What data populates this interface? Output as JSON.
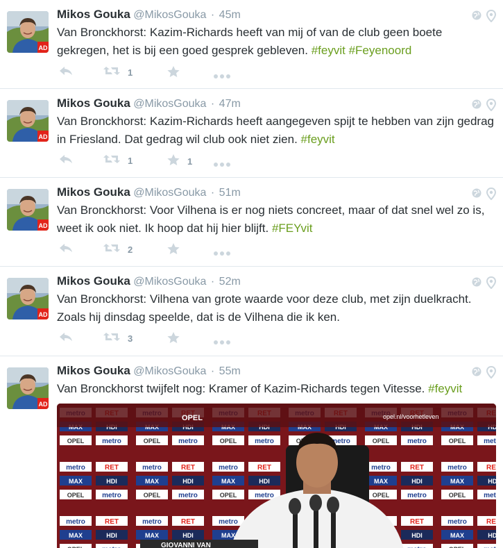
{
  "tweets": [
    {
      "name": "Mikos Gouka",
      "handle": "@MikosGouka",
      "time": "45m",
      "text_parts": [
        {
          "t": "Van Bronckhorst: Kazim-Richards heeft van mij of van de club geen boete gekregen, het is bij een goed gesprek gebleven. ",
          "h": false
        },
        {
          "t": "#feyvit",
          "h": true
        },
        {
          "t": " ",
          "h": false
        },
        {
          "t": "#Feyenoord",
          "h": true
        }
      ],
      "retweets": "1",
      "favorites": ""
    },
    {
      "name": "Mikos Gouka",
      "handle": "@MikosGouka",
      "time": "47m",
      "text_parts": [
        {
          "t": "Van Bronckhorst: Kazim-Richards heeft aangegeven spijt te hebben van zijn gedrag in Friesland. Dat gedrag wil club ook niet zien. ",
          "h": false
        },
        {
          "t": "#feyvit",
          "h": true
        }
      ],
      "retweets": "1",
      "favorites": "1"
    },
    {
      "name": "Mikos Gouka",
      "handle": "@MikosGouka",
      "time": "51m",
      "text_parts": [
        {
          "t": "Van Bronckhorst: Voor Vilhena is er nog niets concreet, maar of dat snel wel zo is, weet ik ook niet. Ik hoop dat hij hier blijft. ",
          "h": false
        },
        {
          "t": "#FEYvit",
          "h": true
        }
      ],
      "retweets": "2",
      "favorites": ""
    },
    {
      "name": "Mikos Gouka",
      "handle": "@MikosGouka",
      "time": "52m",
      "text_parts": [
        {
          "t": "Van Bronckhorst: Vilhena van grote waarde voor deze club, met zijn duelkracht. Zoals hij dinsdag speelde, dat is de Vilhena die ik ken.",
          "h": false
        }
      ],
      "retweets": "3",
      "favorites": ""
    },
    {
      "name": "Mikos Gouka",
      "handle": "@MikosGouka",
      "time": "55m",
      "text_parts": [
        {
          "t": "Van Bronckhorst twijfelt nog: Kramer of Kazim-Richards tegen Vitesse. ",
          "h": false
        },
        {
          "t": "#feyvit",
          "h": true
        }
      ],
      "retweets": "",
      "favorites": ""
    }
  ],
  "media": {
    "sponsor_opel": "OPEL",
    "sponsor_metro": "metro",
    "sponsor_ret": "RET",
    "sponsor_max": "MAX",
    "sponsor_hdi": "HDI",
    "backdrop_url": "opel.nl/voorhetleven",
    "nameplate": "GIOVANNI VAN"
  },
  "colors": {
    "hashtag": "#6a9e1e",
    "muted": "#8899a6",
    "text": "#292f33",
    "ad_badge": "#e2231a"
  }
}
